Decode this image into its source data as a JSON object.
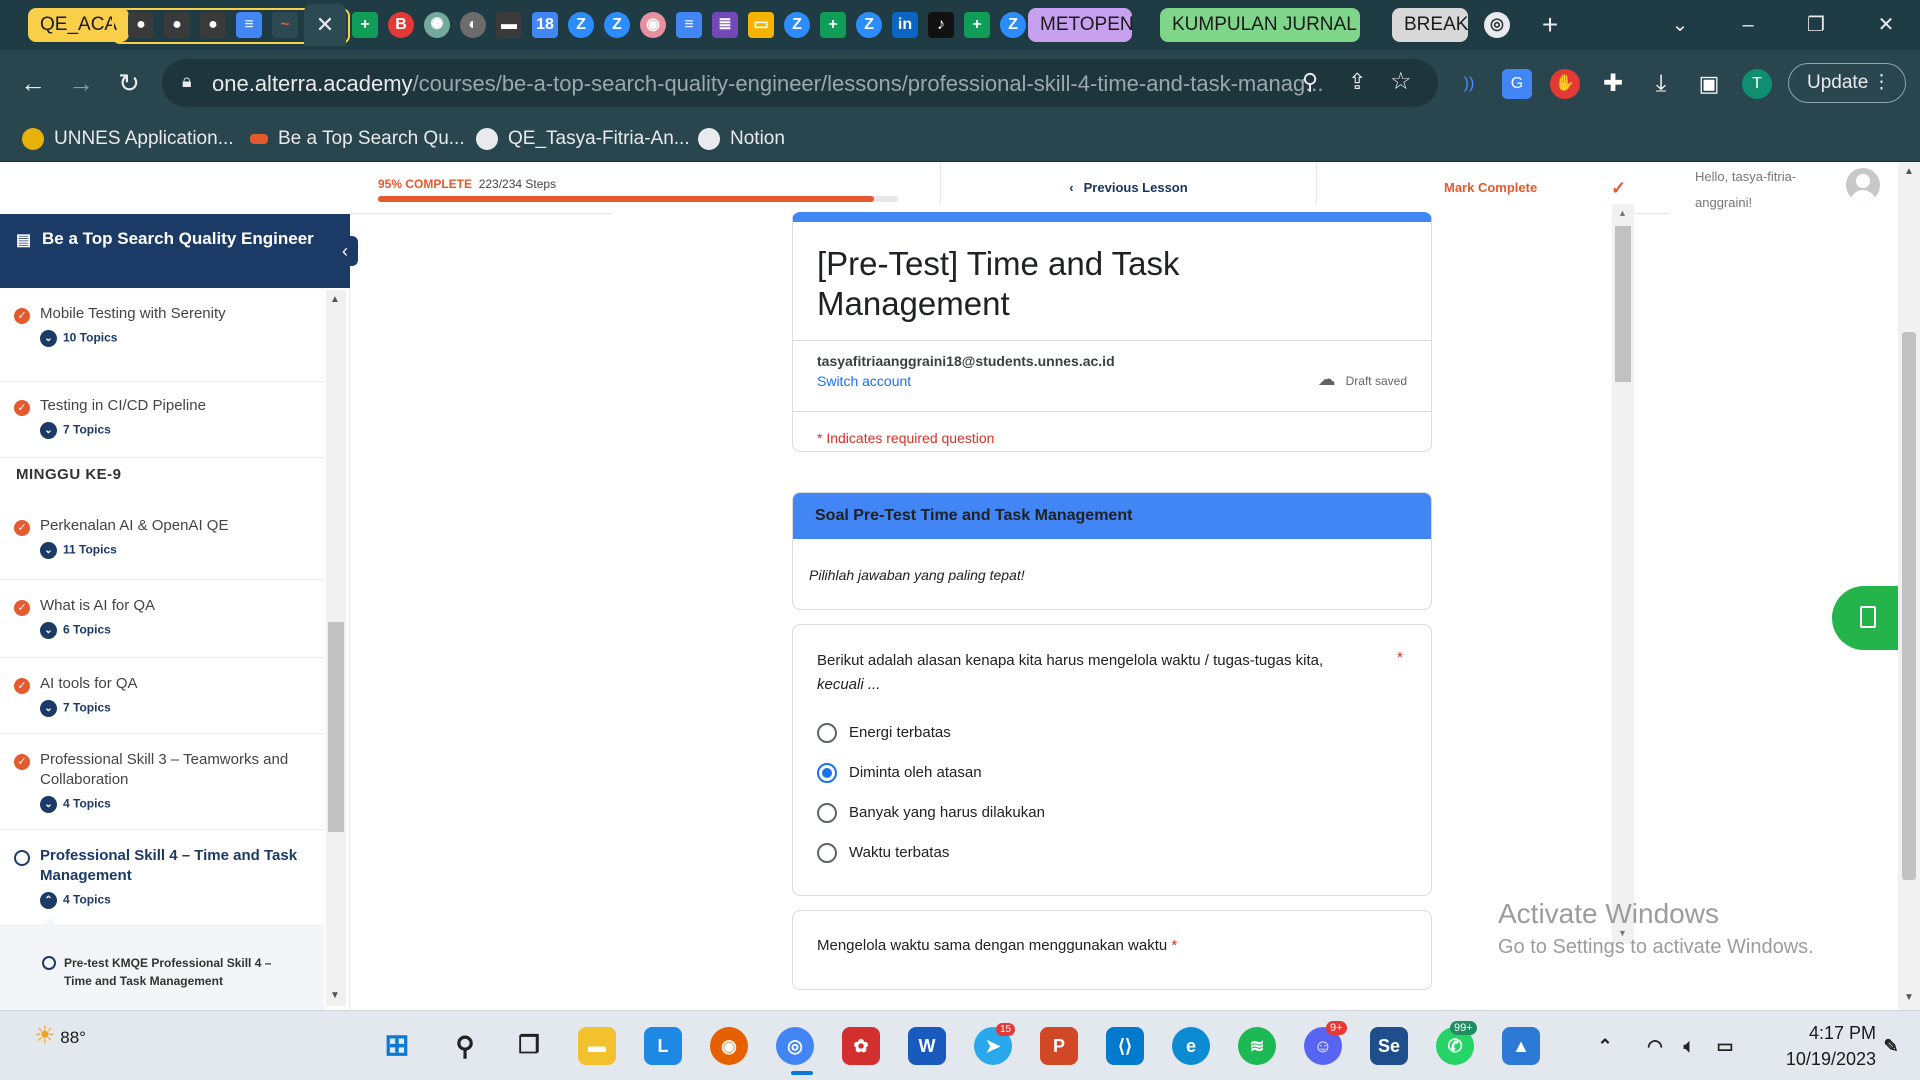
{
  "browser": {
    "tab_groups": [
      {
        "label": "QE_ACA",
        "color": "#f9cf4a"
      },
      {
        "label": "METOPEN",
        "color": "#c7a0f0"
      },
      {
        "label": "KUMPULAN JURNAL [",
        "color": "#7fd58a"
      },
      {
        "label": "BREAK",
        "color": "#d8d8d8"
      }
    ],
    "url_domain": "one.alterra.academy",
    "url_path": "/courses/be-a-top-search-quality-engineer/lessons/professional-skill-4-time-and-task-manag...",
    "update_label": "Update",
    "profile_initial": "T",
    "bookmarks": [
      {
        "label": "UNNES Application..."
      },
      {
        "label": "Be a Top Search Qu..."
      },
      {
        "label": "QE_Tasya-Fitria-An..."
      },
      {
        "label": "Notion"
      }
    ]
  },
  "course": {
    "progress_label": "95% COMPLETE",
    "progress_steps": "223/234 Steps",
    "progress_fraction": 0.953,
    "previous_lesson": "Previous Lesson",
    "mark_complete": "Mark Complete",
    "greeting": "Hello, tasya-fitria-anggraini!",
    "course_title": "Be a Top Search Quality Engineer",
    "lessons_top": [
      {
        "title": "Mobile Testing with Serenity",
        "topics": "10 Topics"
      },
      {
        "title": "Testing in CI/CD Pipeline",
        "topics": "7 Topics"
      }
    ],
    "section_label": "MINGGU KE-9",
    "lessons_week9": [
      {
        "title": "Perkenalan AI & OpenAI QE",
        "topics": "11 Topics"
      },
      {
        "title": "What is AI for QA",
        "topics": "6 Topics"
      },
      {
        "title": "AI tools for QA",
        "topics": "7 Topics"
      },
      {
        "title": "Professional Skill 3 – Teamworks and Collaboration",
        "topics": "4 Topics"
      }
    ],
    "current_lesson": {
      "title": "Professional Skill 4 – Time and Task Management",
      "topics": "4 Topics"
    },
    "current_topic": "Pre-test KMQE Professional Skill 4 – Time and Task Management"
  },
  "form": {
    "title": "[Pre-Test] Time and Task Management",
    "email": "tasyafitriaanggraini18@students.unnes.ac.id",
    "switch_account": "Switch account",
    "draft_status": "Draft saved",
    "required_note": "* Indicates required question",
    "section_title": "Soal Pre-Test Time and Task Management",
    "section_desc": "Pilihlah jawaban yang paling tepat!",
    "q1": {
      "text": "Berikut adalah alasan kenapa kita harus mengelola waktu / tugas-tugas kita,",
      "text_italic": "kecuali ...",
      "options": [
        "Energi terbatas",
        "Diminta oleh atasan",
        "Banyak yang harus dilakukan",
        "Waktu terbatas"
      ],
      "selected_index": 1
    },
    "q2": {
      "text": "Mengelola waktu sama dengan menggunakan waktu"
    }
  },
  "watermark": {
    "line1": "Activate Windows",
    "line2": "Go to Settings to activate Windows."
  },
  "taskbar": {
    "weather_temp": "88°",
    "time": "4:17 PM",
    "date": "10/19/2023",
    "badges": {
      "telegram": "15",
      "discord": "9+",
      "whatsapp": "99+"
    }
  },
  "colors": {
    "accent": "#e5592e",
    "navy": "#1c3a66",
    "forms_blue": "#4285f4"
  }
}
